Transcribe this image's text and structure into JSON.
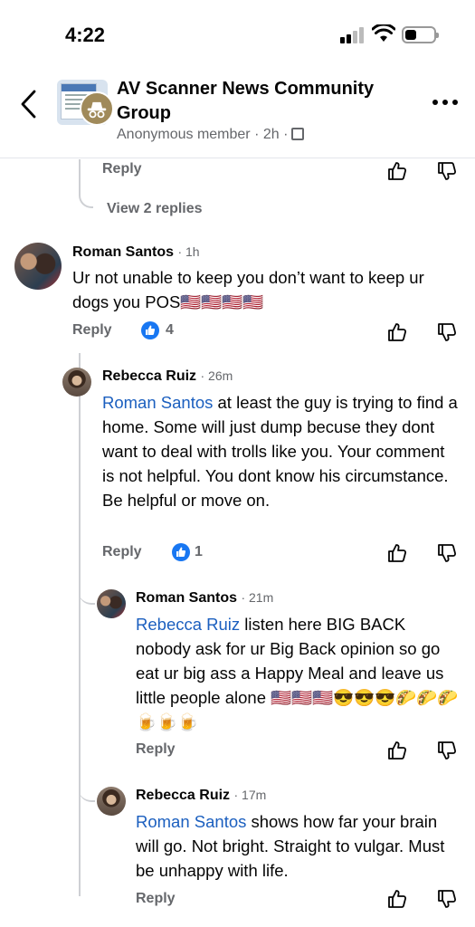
{
  "status_bar": {
    "time": "4:22"
  },
  "header": {
    "title": "AV Scanner News Community Group",
    "subtitle": "Anonymous member · 2h ·"
  },
  "labels": {
    "reply": "Reply"
  },
  "top_thread": {
    "view_replies": "View 2 replies"
  },
  "comments": [
    {
      "author": "Roman Santos",
      "time": "· 1h",
      "text": "Ur not unable to keep you don’t want to keep ur dogs you POS🇺🇸🇺🇸🇺🇸🇺🇸",
      "reactions": "4"
    },
    {
      "author": "Rebecca Ruiz",
      "time": "· 26m",
      "mention": "Roman Santos",
      "text": " at least the guy is trying to find a home. Some will just dump becuse they dont want to deal with trolls like you. Your comment is not helpful. You dont know his circumstance. Be helpful or move on.",
      "reactions": "1"
    },
    {
      "author": "Roman Santos",
      "time": "· 21m",
      "mention": "Rebecca Ruiz",
      "text": " listen here BIG BACK nobody ask for ur Big Back opinion so go eat ur big ass a Happy Meal and leave us little people alone 🇺🇸🇺🇸🇺🇸😎😎😎🌮🌮🌮🍺🍺🍺"
    },
    {
      "author": "Rebecca Ruiz",
      "time": "· 17m",
      "mention": "Roman Santos",
      "text": " shows how far your brain will go. Not bright. Straight to vulgar. Must be unhappy with life."
    }
  ],
  "icons": {
    "back": "chevron-left-icon",
    "more": "more-horizontal-icon",
    "like": "thumbs-up-icon",
    "dislike": "thumbs-down-icon",
    "reaction": "like-reaction-icon",
    "privacy": "members-only-icon",
    "anonymous": "anonymous-badge-icon"
  },
  "colors": {
    "mention": "#1b5fbf",
    "secondary_text": "#65676b",
    "reaction_blue": "#1877f2"
  }
}
